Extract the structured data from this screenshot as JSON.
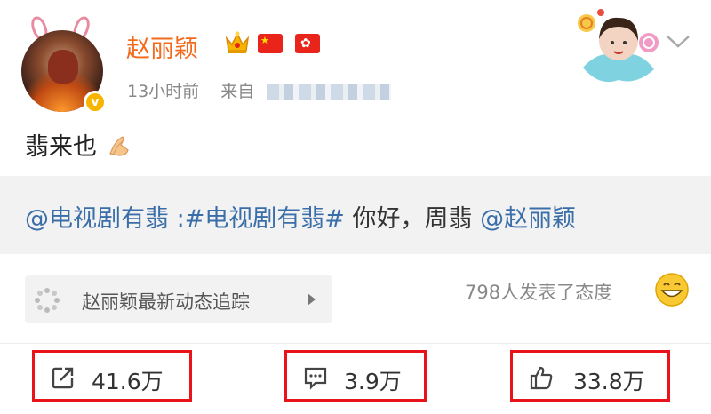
{
  "post": {
    "author_name": "赵丽颖",
    "time": "13小时前",
    "source_prefix": "来自",
    "text": "翡来也",
    "repost": {
      "mention1": "@电视剧有翡",
      "sep": " :",
      "hashtag": "#电视剧有翡#",
      "body": " 你好，周翡 ",
      "mention2": "@赵丽颖"
    }
  },
  "tracker": {
    "label": "赵丽颖最新动态追踪"
  },
  "attitude": {
    "text": "798人发表了态度"
  },
  "actions": {
    "repost_count": "41.6万",
    "comment_count": "3.9万",
    "like_count": "33.8万"
  },
  "icons": {
    "crown": "crown-icon",
    "flag_cn": "china-flag-icon",
    "flag_hk": "hong-kong-flag-icon",
    "verified": "verified-v-badge",
    "hand": "pray-hands-emoji",
    "smile": "grin-emoji",
    "repost": "share-arrow-icon",
    "comment": "comment-icon",
    "like": "thumbs-up-icon",
    "menu": "chevron-down-icon"
  },
  "colors": {
    "name": "#f26b1d",
    "link": "#3a6ea8",
    "highlight_box": "#e8141a",
    "verified": "#f7b500"
  }
}
